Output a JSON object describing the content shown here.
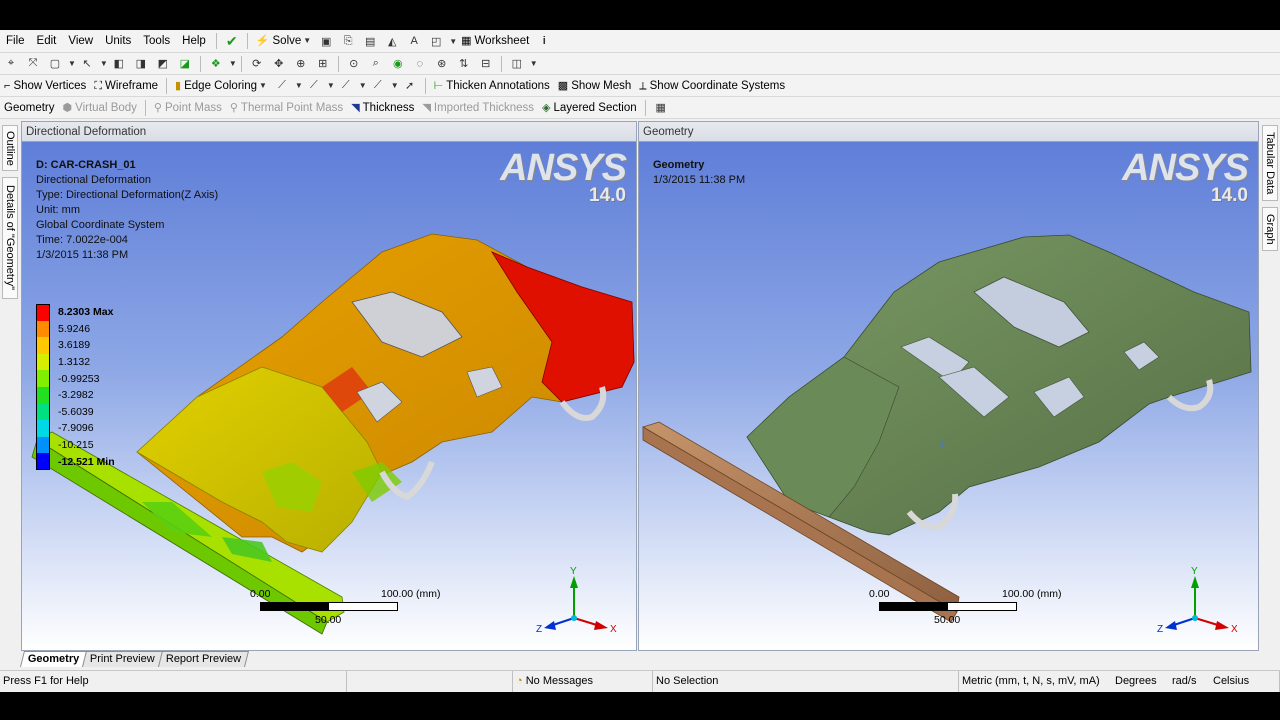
{
  "menu": [
    "File",
    "Edit",
    "View",
    "Units",
    "Tools",
    "Help"
  ],
  "toolbar": {
    "solve": "Solve",
    "worksheet": "Worksheet",
    "show_vertices": "Show Vertices",
    "wireframe": "Wireframe",
    "edge_coloring": "Edge Coloring",
    "thicken_annotations": "Thicken Annotations",
    "show_mesh": "Show Mesh",
    "show_coordinate_systems": "Show Coordinate Systems"
  },
  "context_toolbar": {
    "geometry": "Geometry",
    "virtual_body": "Virtual Body",
    "point_mass": "Point Mass",
    "thermal_point_mass": "Thermal Point Mass",
    "thickness": "Thickness",
    "imported_thickness": "Imported Thickness",
    "layered_section": "Layered Section"
  },
  "side_tabs": {
    "outline": "Outline",
    "details": "Details of \"Geometry\"",
    "tabular": "Tabular Data",
    "graph": "Graph"
  },
  "left_pane": {
    "title": "Directional Deformation",
    "info": {
      "name": "D: CAR-CRASH_01",
      "line1": "Directional Deformation",
      "line2": "Type: Directional Deformation(Z Axis)",
      "line3": "Unit: mm",
      "line4": "Global Coordinate System",
      "line5": "Time: 7.0022e-004",
      "line6": "1/3/2015 11:38 PM"
    },
    "legend": {
      "max_label": "8.2303 Max",
      "values": [
        "5.9246",
        "3.6189",
        "1.3132",
        "-0.99253",
        "-3.2982",
        "-5.6039",
        "-7.9096",
        "-10.215"
      ],
      "min_label": "-12.521 Min",
      "colors": [
        "#ff0000",
        "#ff8c00",
        "#ffc800",
        "#d4f000",
        "#80f000",
        "#22e020",
        "#00e080",
        "#00d8e8",
        "#0090ff",
        "#0000ff"
      ]
    },
    "scale": {
      "left": "0.00",
      "right": "100.00 (mm)",
      "mid": "50.00"
    }
  },
  "right_pane": {
    "title": "Geometry",
    "info": {
      "name": "Geometry",
      "date": "1/3/2015 11:38 PM"
    },
    "scale": {
      "left": "0.00",
      "right": "100.00 (mm)",
      "mid": "50.00"
    }
  },
  "brand": {
    "logo": "ANSYS",
    "version": "14.0"
  },
  "axes": {
    "x": "X",
    "y": "Y",
    "z": "Z"
  },
  "bottom_tabs": [
    "Geometry",
    "Print Preview",
    "Report Preview"
  ],
  "status": {
    "help": "Press F1 for Help",
    "messages": "No Messages",
    "selection": "No Selection",
    "units": "Metric (mm, t, N, s, mV, mA)",
    "angle": "Degrees",
    "rate": "rad/s",
    "temp": "Celsius"
  }
}
